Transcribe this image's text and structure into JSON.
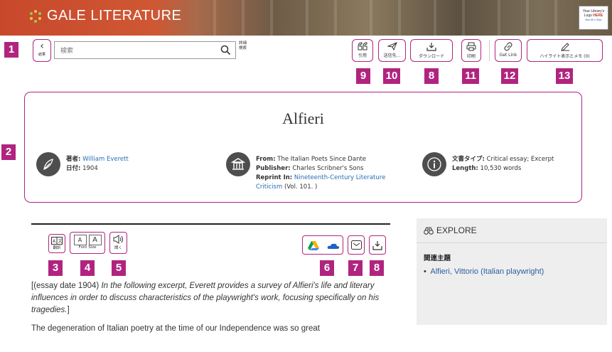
{
  "header": {
    "brand": "GALE LITERATURE",
    "library_logo": {
      "line1": "Your Library's",
      "line2": "Logo",
      "here": "HERE",
      "line3": "Max 85 X 50px"
    }
  },
  "toolbar": {
    "back_label": "結果",
    "search_placeholder": "検索",
    "advanced_search_label": "詳細検索",
    "cite_label": "引用",
    "send_label": "送信先...",
    "download_label": "ダウンロード",
    "print_label": "印刷",
    "get_link_label": "Get Link",
    "highlight_label": "ハイライト表示とメモ (0)"
  },
  "badges": [
    "1",
    "2",
    "3",
    "4",
    "5",
    "6",
    "7",
    "8",
    "9",
    "10",
    "8",
    "11",
    "12",
    "13"
  ],
  "document": {
    "title": "Alfieri",
    "author_label": "著者:",
    "author": "William Everett",
    "date_label": "日付:",
    "date": "1904",
    "from_label": "From:",
    "from": "The Italian Poets Since Dante",
    "publisher_label": "Publisher:",
    "publisher": "Charles Scribner's Sons",
    "reprint_label": "Reprint In:",
    "reprint_link": "Nineteenth-Century Literature Criticism",
    "reprint_vol": "(Vol. 101. )",
    "doctype_label": "文書タイプ:",
    "doctype": "Critical essay; Excerpt",
    "length_label": "Length:",
    "length": "10,530 words"
  },
  "content_tools": {
    "translate_label": "翻訳",
    "font_size_label": "Font Size",
    "font_a_small": "A",
    "font_a_large": "A",
    "listen_label": "聞く"
  },
  "article": {
    "intro_prefix": "[(essay date 1904)",
    "intro_italic": "In the following excerpt, Everett provides a survey of Alfieri's life and literary influences in order to discuss characteristics of the playwright's work, focusing specifically on his tragedies.",
    "intro_suffix": "]",
    "para1": "The degeneration of Italian poetry at the time of our Independence was so great"
  },
  "sidebar": {
    "explore_label": "EXPLORE",
    "related_title": "関連主題",
    "related_items": [
      "Alfieri, Vittorio (Italian playwright)"
    ]
  },
  "colors": {
    "accent": "#b0247f",
    "header": "#c8482c",
    "link": "#2a6eb0"
  }
}
